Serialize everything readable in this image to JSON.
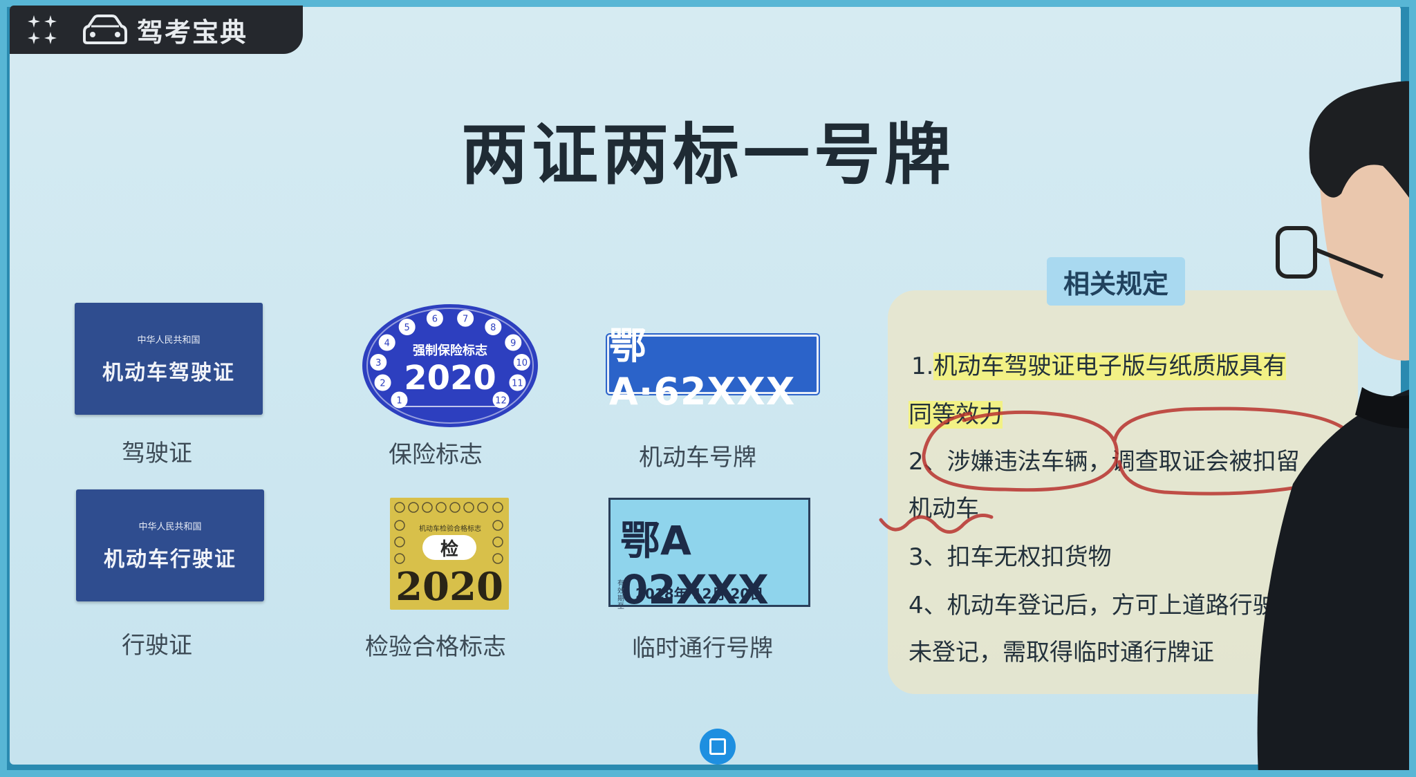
{
  "app": {
    "name": "驾考宝典"
  },
  "title": "两证两标一号牌",
  "items": {
    "driver_license": {
      "card_small": "中华人民共和国",
      "card_big": "机动车驾驶证",
      "caption": "驾驶证"
    },
    "insurance": {
      "label": "强制保险标志",
      "year": "2020",
      "months": [
        "1",
        "2",
        "3",
        "4",
        "5",
        "6",
        "7",
        "8",
        "9",
        "10",
        "11",
        "12"
      ],
      "caption": "保险标志"
    },
    "plate": {
      "text": "鄂A·62XXX",
      "caption": "机动车号牌"
    },
    "vehicle_license": {
      "card_small": "中华人民共和国",
      "card_big": "机动车行驶证",
      "caption": "行驶证"
    },
    "inspection": {
      "label": "机动车检验合格标志",
      "badge": "检",
      "year": "2020",
      "caption": "检验合格标志"
    },
    "temp_plate": {
      "text": "鄂A 02XXX",
      "valid": "有效期至",
      "date": "2018年  12月  20日",
      "caption": "临时通行号牌"
    }
  },
  "rules": {
    "heading": "相关规定",
    "lines": [
      {
        "pre": "1.",
        "hl": "机动车驾驶证电子版与纸质版具有",
        "post": ""
      },
      {
        "pre": "",
        "hl": "同等效力",
        "post": ""
      },
      {
        "pre": "2、",
        "hl": "",
        "post": "涉嫌违法车辆，调查取证会被扣留"
      },
      {
        "pre": "",
        "hl": "",
        "post": "机动车"
      },
      {
        "pre": "",
        "hl": "",
        "post": "3、扣车无权扣货物"
      },
      {
        "pre": "",
        "hl": "",
        "post": "4、机动车登记后，方可上道路行驶"
      },
      {
        "pre": "",
        "hl": "",
        "post": "未登记，需取得临时通行牌证"
      }
    ]
  },
  "colors": {
    "card_blue": "#2f4d8f",
    "plate_blue": "#2b63c9",
    "sticker_yellow": "#d8c04a",
    "ink_red": "#b8322e",
    "accent": "#1e8fe0"
  }
}
